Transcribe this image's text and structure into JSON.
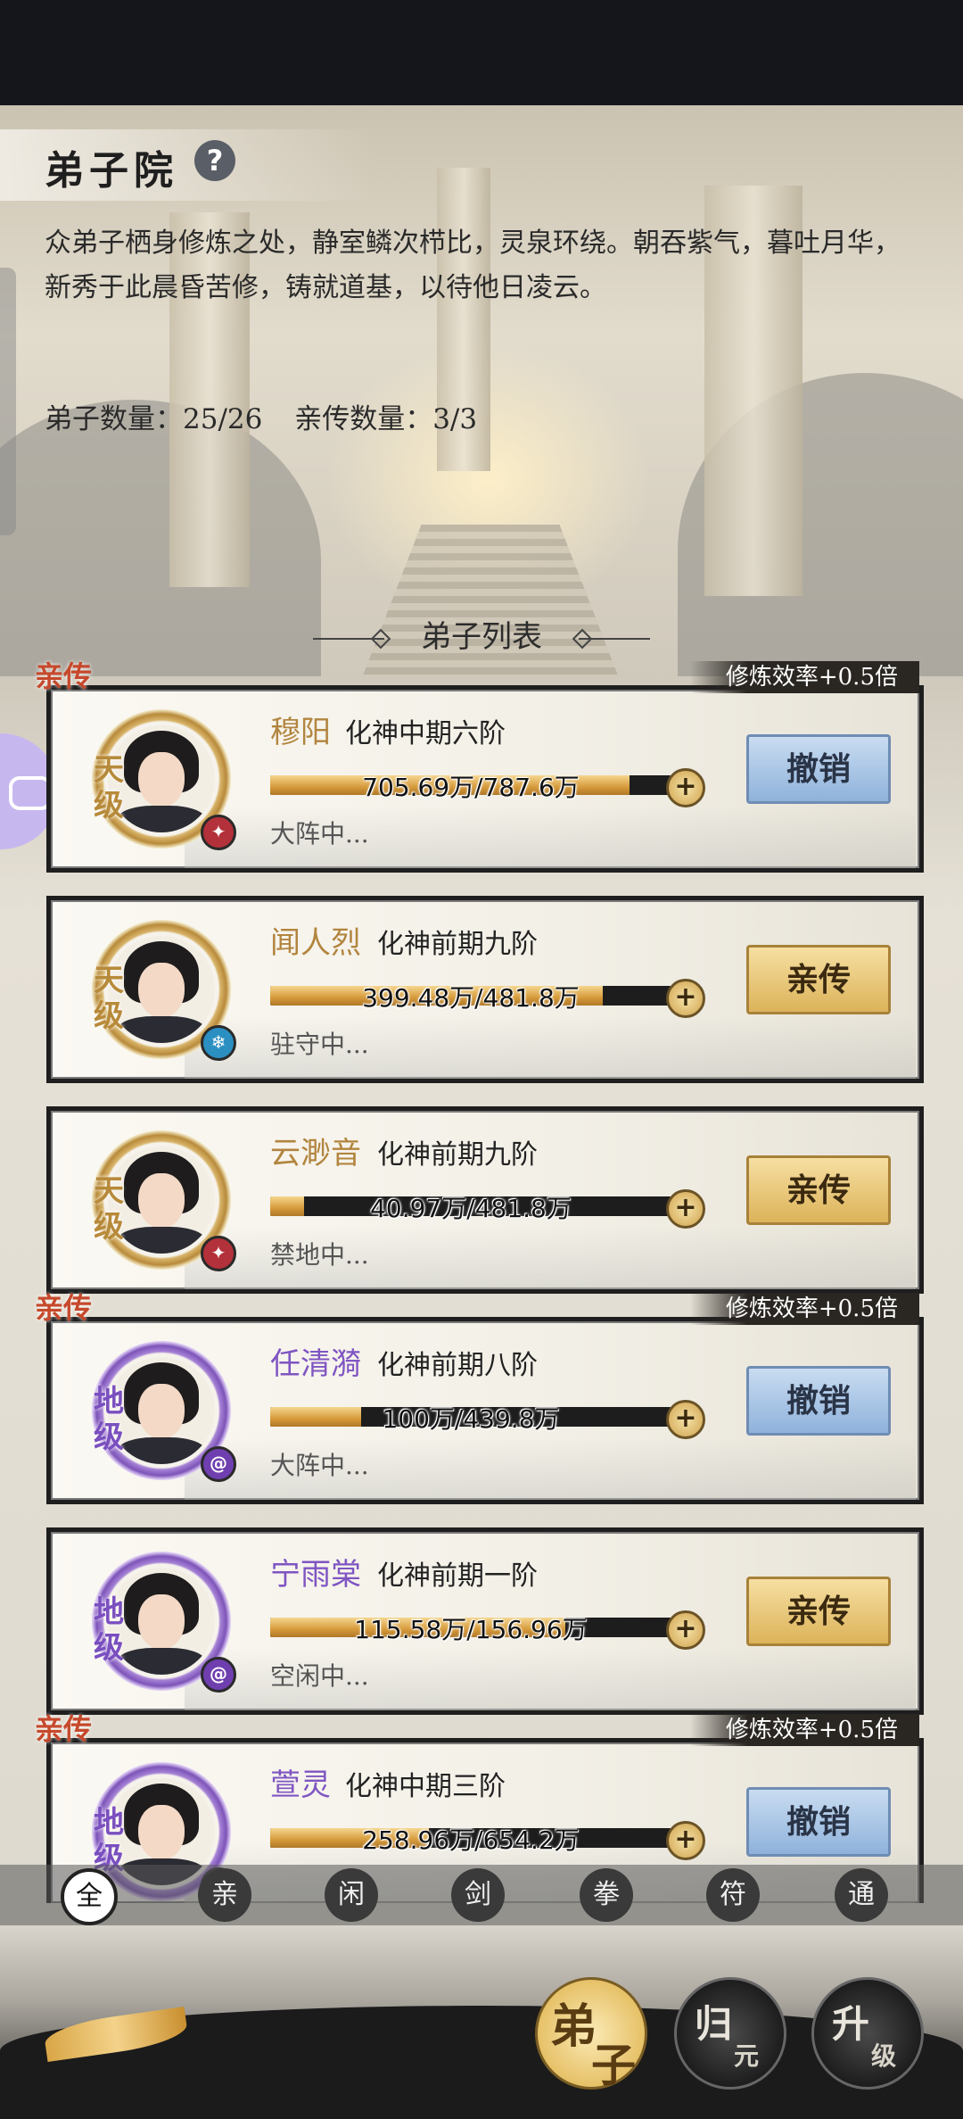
{
  "header": {
    "title": "弟子院",
    "help_icon": "?",
    "description": "众弟子栖身修炼之处，静室鳞次栉比，灵泉环绕。朝吞紫气，暮吐月华，新秀于此晨昏苦修，铸就道基，以待他日凌云。",
    "disciple_count": "弟子数量：25/26",
    "direct_count": "亲传数量：3/3"
  },
  "list_title": "弟子列表",
  "disciples": [
    {
      "tag": "亲传",
      "bonus": "修炼效率+0.5倍",
      "grade": "天级",
      "name": "穆阳",
      "realm": "化神中期六阶",
      "progress_text": "705.69万/787.6万",
      "progress": 0.896,
      "status": "大阵中...",
      "button": "撤销",
      "element_icon": "fire-element-icon"
    },
    {
      "tag": "",
      "bonus": "",
      "grade": "天级",
      "name": "闻人烈",
      "realm": "化神前期九阶",
      "progress_text": "399.48万/481.8万",
      "progress": 0.829,
      "status": "驻守中...",
      "button": "亲传",
      "element_icon": "ice-element-icon"
    },
    {
      "tag": "",
      "bonus": "",
      "grade": "天级",
      "name": "云渺音",
      "realm": "化神前期九阶",
      "progress_text": "40.97万/481.8万",
      "progress": 0.085,
      "status": "禁地中...",
      "button": "亲传",
      "element_icon": "fire-element-icon"
    },
    {
      "tag": "亲传",
      "bonus": "修炼效率+0.5倍",
      "grade": "地级",
      "name": "任清漪",
      "realm": "化神前期八阶",
      "progress_text": "100万/439.8万",
      "progress": 0.227,
      "status": "大阵中...",
      "button": "撤销",
      "element_icon": "wind-element-icon"
    },
    {
      "tag": "",
      "bonus": "",
      "grade": "地级",
      "name": "宁雨棠",
      "realm": "化神前期一阶",
      "progress_text": "115.58万/156.96万",
      "progress": 0.736,
      "status": "空闲中...",
      "button": "亲传",
      "element_icon": "wind-element-icon"
    },
    {
      "tag": "亲传",
      "bonus": "修炼效率+0.5倍",
      "grade": "地级",
      "name": "萱灵",
      "realm": "化神中期三阶",
      "progress_text": "258.96万/654.2万",
      "progress": 0.396,
      "status": "",
      "button": "撤销",
      "element_icon": "wind-element-icon"
    }
  ],
  "filters": [
    "全",
    "亲",
    "闲",
    "剑",
    "拳",
    "符",
    "通"
  ],
  "active_filter": "全",
  "bottom_nav": [
    {
      "t1": "弟",
      "t2": "子"
    },
    {
      "t1": "归",
      "t2": "元"
    },
    {
      "t1": "升",
      "t2": "级"
    }
  ],
  "colors": {
    "tian": "#b78a3a",
    "di": "#7a4fbf",
    "tag": "#c6492c"
  }
}
